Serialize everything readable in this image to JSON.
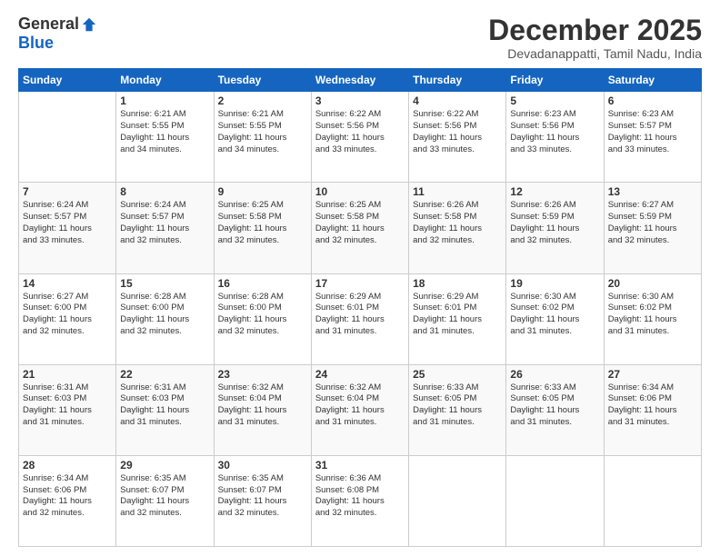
{
  "header": {
    "logo_line1": "General",
    "logo_line2": "Blue",
    "month": "December 2025",
    "location": "Devadanappatti, Tamil Nadu, India"
  },
  "weekdays": [
    "Sunday",
    "Monday",
    "Tuesday",
    "Wednesday",
    "Thursday",
    "Friday",
    "Saturday"
  ],
  "weeks": [
    [
      {
        "day": "",
        "info": ""
      },
      {
        "day": "1",
        "info": "Sunrise: 6:21 AM\nSunset: 5:55 PM\nDaylight: 11 hours\nand 34 minutes."
      },
      {
        "day": "2",
        "info": "Sunrise: 6:21 AM\nSunset: 5:55 PM\nDaylight: 11 hours\nand 34 minutes."
      },
      {
        "day": "3",
        "info": "Sunrise: 6:22 AM\nSunset: 5:56 PM\nDaylight: 11 hours\nand 33 minutes."
      },
      {
        "day": "4",
        "info": "Sunrise: 6:22 AM\nSunset: 5:56 PM\nDaylight: 11 hours\nand 33 minutes."
      },
      {
        "day": "5",
        "info": "Sunrise: 6:23 AM\nSunset: 5:56 PM\nDaylight: 11 hours\nand 33 minutes."
      },
      {
        "day": "6",
        "info": "Sunrise: 6:23 AM\nSunset: 5:57 PM\nDaylight: 11 hours\nand 33 minutes."
      }
    ],
    [
      {
        "day": "7",
        "info": "Sunrise: 6:24 AM\nSunset: 5:57 PM\nDaylight: 11 hours\nand 33 minutes."
      },
      {
        "day": "8",
        "info": "Sunrise: 6:24 AM\nSunset: 5:57 PM\nDaylight: 11 hours\nand 32 minutes."
      },
      {
        "day": "9",
        "info": "Sunrise: 6:25 AM\nSunset: 5:58 PM\nDaylight: 11 hours\nand 32 minutes."
      },
      {
        "day": "10",
        "info": "Sunrise: 6:25 AM\nSunset: 5:58 PM\nDaylight: 11 hours\nand 32 minutes."
      },
      {
        "day": "11",
        "info": "Sunrise: 6:26 AM\nSunset: 5:58 PM\nDaylight: 11 hours\nand 32 minutes."
      },
      {
        "day": "12",
        "info": "Sunrise: 6:26 AM\nSunset: 5:59 PM\nDaylight: 11 hours\nand 32 minutes."
      },
      {
        "day": "13",
        "info": "Sunrise: 6:27 AM\nSunset: 5:59 PM\nDaylight: 11 hours\nand 32 minutes."
      }
    ],
    [
      {
        "day": "14",
        "info": "Sunrise: 6:27 AM\nSunset: 6:00 PM\nDaylight: 11 hours\nand 32 minutes."
      },
      {
        "day": "15",
        "info": "Sunrise: 6:28 AM\nSunset: 6:00 PM\nDaylight: 11 hours\nand 32 minutes."
      },
      {
        "day": "16",
        "info": "Sunrise: 6:28 AM\nSunset: 6:00 PM\nDaylight: 11 hours\nand 32 minutes."
      },
      {
        "day": "17",
        "info": "Sunrise: 6:29 AM\nSunset: 6:01 PM\nDaylight: 11 hours\nand 31 minutes."
      },
      {
        "day": "18",
        "info": "Sunrise: 6:29 AM\nSunset: 6:01 PM\nDaylight: 11 hours\nand 31 minutes."
      },
      {
        "day": "19",
        "info": "Sunrise: 6:30 AM\nSunset: 6:02 PM\nDaylight: 11 hours\nand 31 minutes."
      },
      {
        "day": "20",
        "info": "Sunrise: 6:30 AM\nSunset: 6:02 PM\nDaylight: 11 hours\nand 31 minutes."
      }
    ],
    [
      {
        "day": "21",
        "info": "Sunrise: 6:31 AM\nSunset: 6:03 PM\nDaylight: 11 hours\nand 31 minutes."
      },
      {
        "day": "22",
        "info": "Sunrise: 6:31 AM\nSunset: 6:03 PM\nDaylight: 11 hours\nand 31 minutes."
      },
      {
        "day": "23",
        "info": "Sunrise: 6:32 AM\nSunset: 6:04 PM\nDaylight: 11 hours\nand 31 minutes."
      },
      {
        "day": "24",
        "info": "Sunrise: 6:32 AM\nSunset: 6:04 PM\nDaylight: 11 hours\nand 31 minutes."
      },
      {
        "day": "25",
        "info": "Sunrise: 6:33 AM\nSunset: 6:05 PM\nDaylight: 11 hours\nand 31 minutes."
      },
      {
        "day": "26",
        "info": "Sunrise: 6:33 AM\nSunset: 6:05 PM\nDaylight: 11 hours\nand 31 minutes."
      },
      {
        "day": "27",
        "info": "Sunrise: 6:34 AM\nSunset: 6:06 PM\nDaylight: 11 hours\nand 31 minutes."
      }
    ],
    [
      {
        "day": "28",
        "info": "Sunrise: 6:34 AM\nSunset: 6:06 PM\nDaylight: 11 hours\nand 32 minutes."
      },
      {
        "day": "29",
        "info": "Sunrise: 6:35 AM\nSunset: 6:07 PM\nDaylight: 11 hours\nand 32 minutes."
      },
      {
        "day": "30",
        "info": "Sunrise: 6:35 AM\nSunset: 6:07 PM\nDaylight: 11 hours\nand 32 minutes."
      },
      {
        "day": "31",
        "info": "Sunrise: 6:36 AM\nSunset: 6:08 PM\nDaylight: 11 hours\nand 32 minutes."
      },
      {
        "day": "",
        "info": ""
      },
      {
        "day": "",
        "info": ""
      },
      {
        "day": "",
        "info": ""
      }
    ]
  ]
}
